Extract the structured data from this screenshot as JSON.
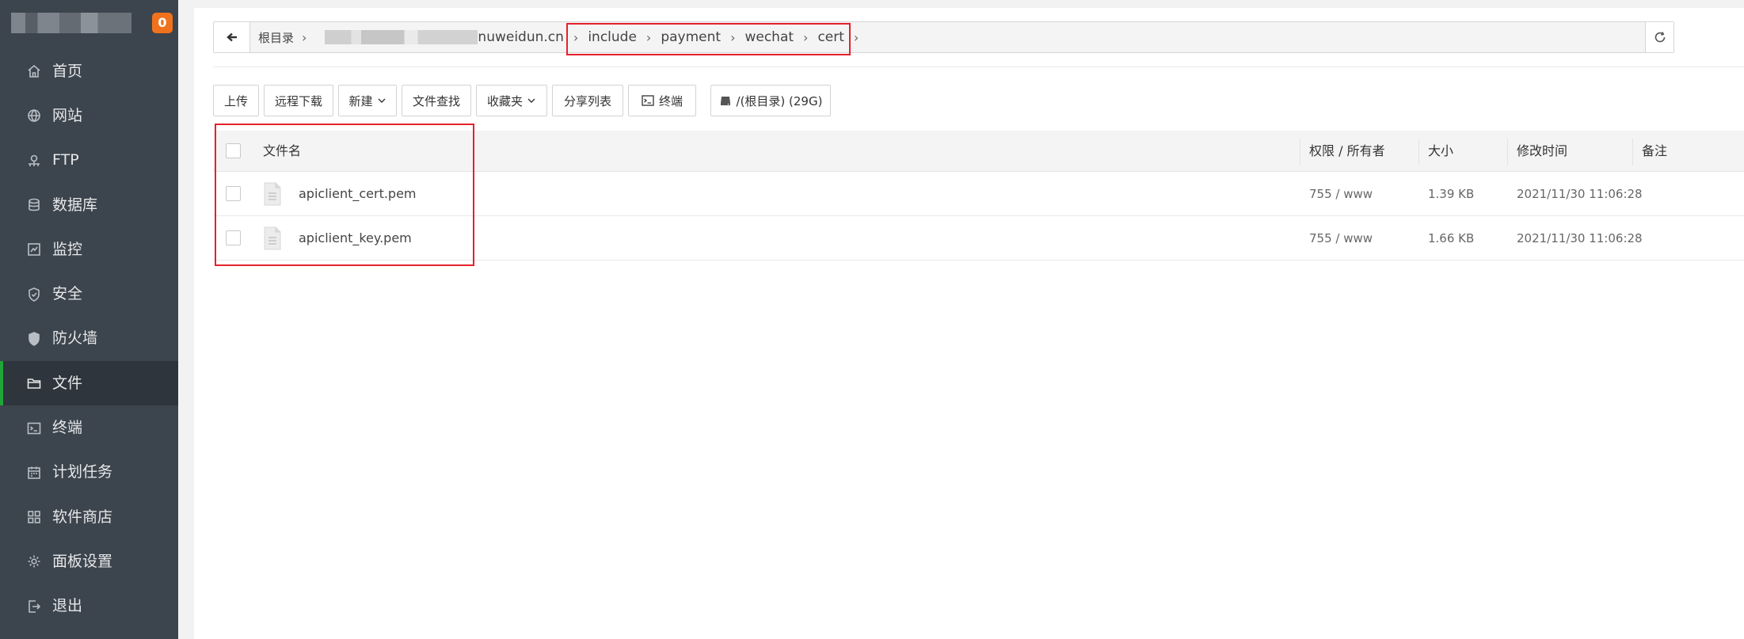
{
  "sidebar": {
    "badge": "0",
    "items": [
      {
        "label": "首页",
        "icon": "home-icon"
      },
      {
        "label": "网站",
        "icon": "globe-icon"
      },
      {
        "label": "FTP",
        "icon": "ftp-icon"
      },
      {
        "label": "数据库",
        "icon": "database-icon"
      },
      {
        "label": "监控",
        "icon": "monitor-icon"
      },
      {
        "label": "安全",
        "icon": "shield-icon"
      },
      {
        "label": "防火墙",
        "icon": "firewall-icon"
      },
      {
        "label": "文件",
        "icon": "folder-icon"
      },
      {
        "label": "终端",
        "icon": "terminal-icon"
      },
      {
        "label": "计划任务",
        "icon": "calendar-icon"
      },
      {
        "label": "软件商店",
        "icon": "apps-icon"
      },
      {
        "label": "面板设置",
        "icon": "gear-icon"
      },
      {
        "label": "退出",
        "icon": "logout-icon"
      }
    ],
    "active_index": 7
  },
  "path": {
    "root": "根目录",
    "domain_tail": "nuweidun.cn",
    "segments": [
      "include",
      "payment",
      "wechat",
      "cert"
    ]
  },
  "toolbar": {
    "upload": "上传",
    "remote_download": "远程下载",
    "new": "新建",
    "file_search": "文件查找",
    "favorites": "收藏夹",
    "share_list": "分享列表",
    "terminal": "终端",
    "disk": "/(根目录) (29G)"
  },
  "table": {
    "headers": {
      "name": "文件名",
      "perm": "权限 / 所有者",
      "size": "大小",
      "mtime": "修改时间",
      "remark": "备注"
    },
    "rows": [
      {
        "name": "apiclient_cert.pem",
        "perm": "755 / www",
        "size": "1.39 KB",
        "mtime": "2021/11/30 11:06:28"
      },
      {
        "name": "apiclient_key.pem",
        "perm": "755 / www",
        "size": "1.66 KB",
        "mtime": "2021/11/30 11:06:28"
      }
    ]
  },
  "colors": {
    "sidebar_bg": "#3c444d",
    "active_accent": "#20a53a",
    "badge": "#f0721d",
    "highlight": "#e5212b"
  }
}
